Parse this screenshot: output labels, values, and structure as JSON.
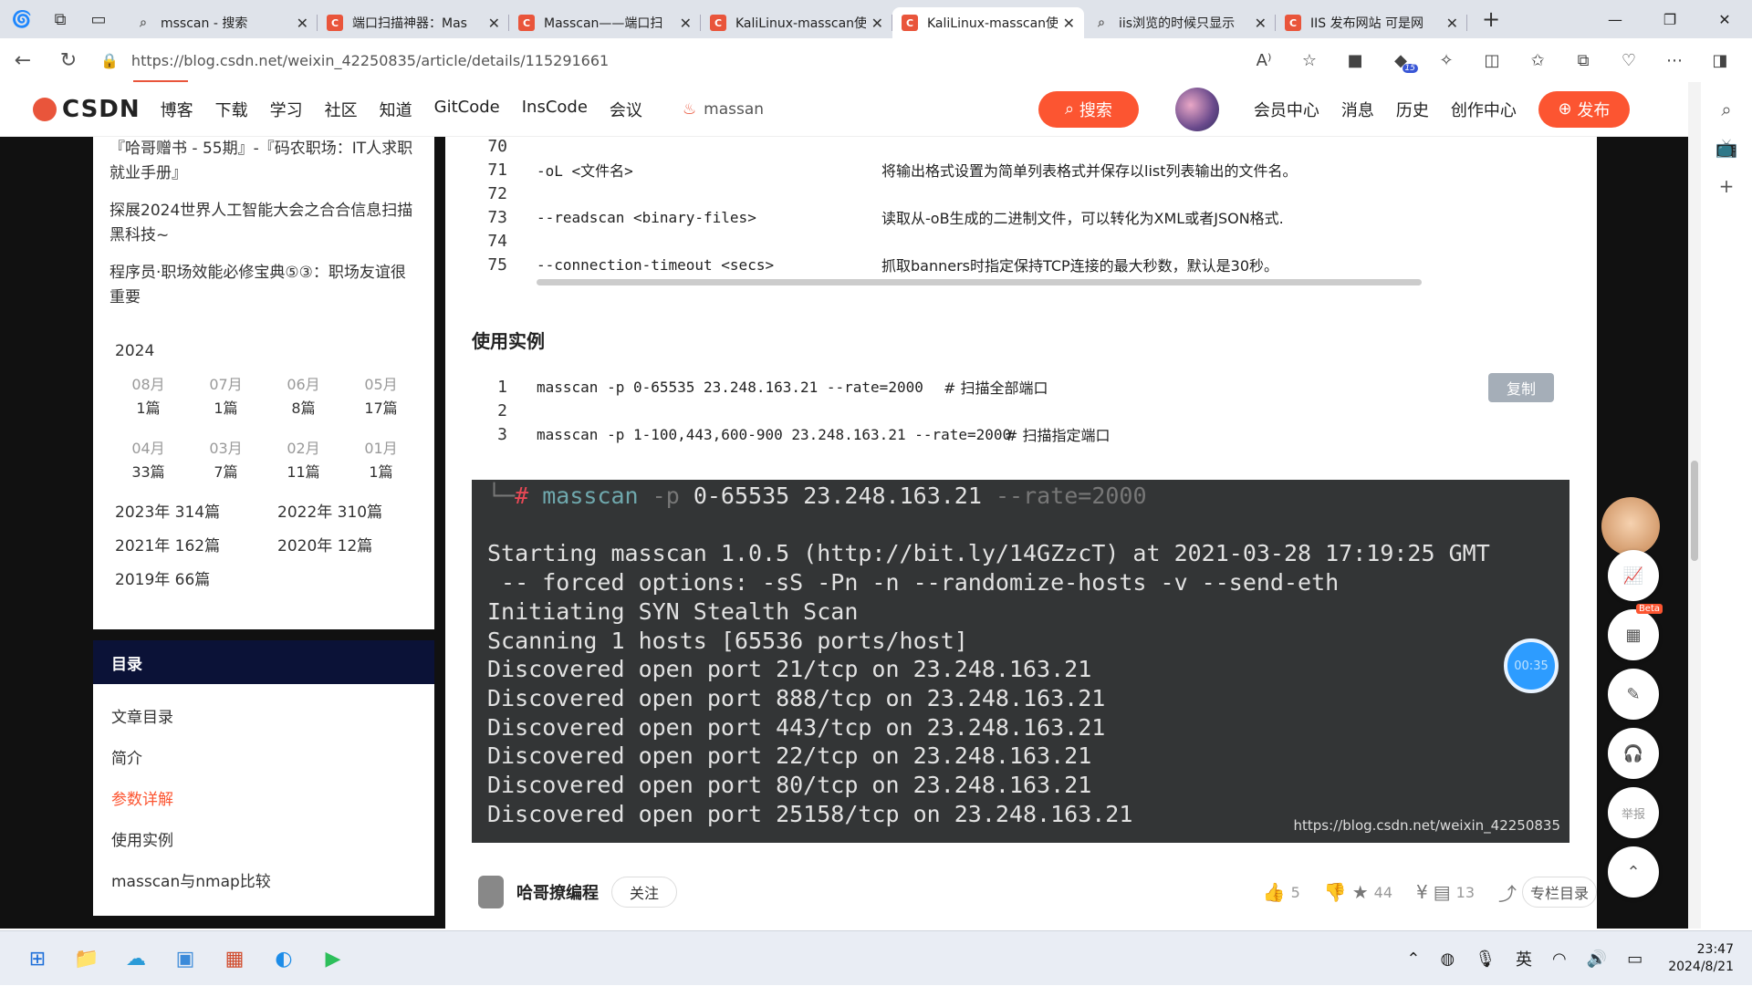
{
  "browser": {
    "tabs": [
      {
        "title": "msscan - 搜索",
        "kind": "search"
      },
      {
        "title": "端口扫描神器：Mas",
        "kind": "csdn"
      },
      {
        "title": "Masscan——端口扫",
        "kind": "csdn"
      },
      {
        "title": "KaliLinux-masscan使",
        "kind": "csdn"
      },
      {
        "title": "KaliLinux-masscan使",
        "kind": "csdn",
        "active": true
      },
      {
        "title": "iis浏览的时候只显示",
        "kind": "search"
      },
      {
        "title": "IIS 发布网站 可是网",
        "kind": "csdn"
      }
    ],
    "url": "https://blog.csdn.net/weixin_42250835/article/details/115291661",
    "ext_badge": "15"
  },
  "csdn": {
    "logo": "CSDN",
    "menu": [
      "博客",
      "下载",
      "学习",
      "社区",
      "知道",
      "GitCode",
      "InsCode",
      "会议"
    ],
    "search_placeholder": "massan",
    "search_button": "搜索",
    "user_menu": [
      "会员中心",
      "消息",
      "历史",
      "创作中心"
    ],
    "publish": "发布"
  },
  "left": {
    "hot": [
      "『哈哥赠书 - 55期』-『码农职场：IT人求职就业手册』",
      "探展2024世界人工智能大会之合合信息扫描黑科技~",
      "程序员·职场效能必修宝典⑤③：职场友谊很重要"
    ],
    "year": "2024",
    "months": [
      {
        "m": "08月",
        "c": "1篇"
      },
      {
        "m": "07月",
        "c": "1篇"
      },
      {
        "m": "06月",
        "c": "8篇"
      },
      {
        "m": "05月",
        "c": "17篇"
      },
      {
        "m": "04月",
        "c": "33篇"
      },
      {
        "m": "03月",
        "c": "7篇"
      },
      {
        "m": "02月",
        "c": "11篇"
      },
      {
        "m": "01月",
        "c": "1篇"
      }
    ],
    "years": [
      "2023年 314篇",
      "2022年 310篇",
      "2021年 162篇",
      "2020年 12篇",
      "2019年 66篇"
    ],
    "toc_title": "目录",
    "toc": [
      "文章目录",
      "简介",
      "参数详解",
      "使用实例",
      "masscan与nmap比较"
    ]
  },
  "article": {
    "params": [
      {
        "ln": "70",
        "opt": "",
        "desc": ""
      },
      {
        "ln": "71",
        "opt": "-oL <文件名>",
        "desc": "将输出格式设置为简单列表格式并保存以list列表输出的文件名。"
      },
      {
        "ln": "72",
        "opt": "",
        "desc": ""
      },
      {
        "ln": "73",
        "opt": "--readscan <binary-files>",
        "desc": "读取从-oB生成的二进制文件，可以转化为XML或者JSON格式."
      },
      {
        "ln": "74",
        "opt": "",
        "desc": ""
      },
      {
        "ln": "75",
        "opt": "--connection-timeout <secs>",
        "desc": "抓取banners时指定保持TCP连接的最大秒数，默认是30秒。"
      }
    ],
    "section_title": "使用实例",
    "copy_label": "复制",
    "example": [
      {
        "ln": "1",
        "code": "masscan -p 0-65535 23.248.163.21 --rate=2000",
        "comment": "# 扫描全部端口"
      },
      {
        "ln": "2",
        "code": "",
        "comment": ""
      },
      {
        "ln": "3",
        "code": "masscan -p 1-100,443,600-900 23.248.163.21 --rate=2000",
        "comment": "# 扫描指定端口"
      }
    ],
    "terminal": {
      "prompt_cmd": "masscan",
      "prompt_flag": "-p",
      "prompt_args": "0-65535 23.248.163.21",
      "prompt_rate": "--rate=2000",
      "lines": [
        "Starting masscan 1.0.5 (http://bit.ly/14GZzcT) at 2021-03-28 17:19:25 GMT",
        " -- forced options: -sS -Pn -n --randomize-hosts -v --send-eth",
        "Initiating SYN Stealth Scan",
        "Scanning 1 hosts [65536 ports/host]",
        "Discovered open port 21/tcp on 23.248.163.21",
        "Discovered open port 888/tcp on 23.248.163.21",
        "Discovered open port 443/tcp on 23.248.163.21",
        "Discovered open port 22/tcp on 23.248.163.21",
        "Discovered open port 80/tcp on 23.248.163.21",
        "Discovered open port 25158/tcp on 23.248.163.21"
      ],
      "watermark": "https://blog.csdn.net/weixin_42250835",
      "timer": "00:35"
    },
    "author": {
      "name": "哈哥撩编程",
      "follow": "关注",
      "likes": "5",
      "stars": "44",
      "comments": "13",
      "column_dir": "专栏目录"
    }
  },
  "float": {
    "report": "举报",
    "beta": "Beta"
  },
  "taskbar": {
    "time": "23:47",
    "date": "2024/8/21",
    "ime": "英"
  }
}
